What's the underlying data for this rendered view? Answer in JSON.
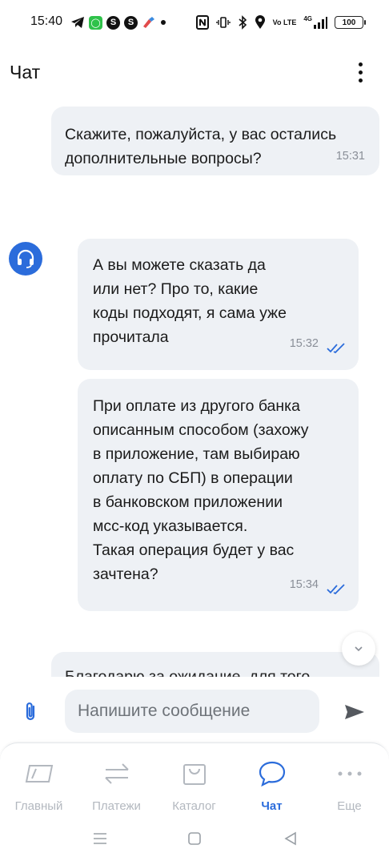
{
  "status_bar": {
    "time": "15:40",
    "left_icons": [
      "telegram-icon",
      "whatsapp-icon",
      "app-s-icon",
      "app-s-icon",
      "paint-icon",
      "dot-icon"
    ],
    "right_icons": [
      "nfc-icon",
      "vibrate-icon",
      "bluetooth-icon",
      "location-icon",
      "volte-icon",
      "signal-icon"
    ],
    "volte_text": "Vo LTE",
    "network_text": "4G",
    "battery": "100"
  },
  "header": {
    "title": "Чат"
  },
  "messages": [
    {
      "direction": "incoming",
      "text": "Скажите, пожалуйста, у вас остались\nдополнительные вопросы?",
      "time": "15:31"
    },
    {
      "direction": "outgoing",
      "text": "А вы можете сказать да\nили нет? Про то, какие\nкоды подходят, я сама уже\nпрочитала",
      "time": "15:32",
      "read": true
    },
    {
      "direction": "outgoing",
      "text": "При оплате из другого банка\nописанным способом (захожу\nв приложение, там выбираю\nоплату по СБП) в операции\nв банковском приложении\nмсс-код указывается.\nТакая операция будет у вас\nзачтена?",
      "time": "15:34",
      "read": true
    },
    {
      "direction": "incoming",
      "text": "Благодарю за ожидание, для того"
    }
  ],
  "composer": {
    "placeholder": "Напишите сообщение"
  },
  "bottom_nav": {
    "items": [
      {
        "label": "Главный",
        "icon": "home-card-icon",
        "active": false
      },
      {
        "label": "Платежи",
        "icon": "transfer-arrows-icon",
        "active": false
      },
      {
        "label": "Каталог",
        "icon": "shopping-bag-icon",
        "active": false
      },
      {
        "label": "Чат",
        "icon": "chat-bubble-icon",
        "active": true
      },
      {
        "label": "Еще",
        "icon": "more-dots-icon",
        "active": false
      }
    ]
  },
  "colors": {
    "accent": "#2b6cdb",
    "bubble": "#eef1f5",
    "inactive": "#b3b8bf"
  }
}
